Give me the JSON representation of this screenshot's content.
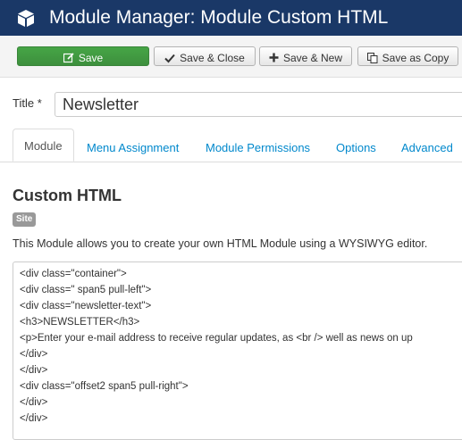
{
  "header": {
    "title": "Module Manager: Module Custom HTML",
    "icon": "cube-icon"
  },
  "toolbar": {
    "save": "Save",
    "save_close": "Save & Close",
    "save_new": "Save & New",
    "save_copy": "Save as Copy"
  },
  "form": {
    "title_label": "Title *",
    "title_value": "Newsletter"
  },
  "tabs": [
    "Module",
    "Menu Assignment",
    "Module Permissions",
    "Options",
    "Advanced"
  ],
  "content": {
    "heading": "Custom HTML",
    "badge": "Site",
    "description": "This Module allows you to create your own HTML Module using a WYSIWYG editor."
  },
  "editor": {
    "lines": [
      "<div class=\"container\">",
      "<div class=\" span5 pull-left\">",
      "<div class=\"newsletter-text\">",
      "<h3>NEWSLETTER</h3>",
      "<p>Enter your e-mail address to receive regular updates, as <br /> well as news on up",
      "</div>",
      "</div>",
      "<div class=\"offset2 span5 pull-right\">",
      "</div>",
      "</div>"
    ]
  },
  "colors": {
    "header_bg": "#1a3867",
    "save_green": "#46a546",
    "link_blue": "#0088cc"
  }
}
